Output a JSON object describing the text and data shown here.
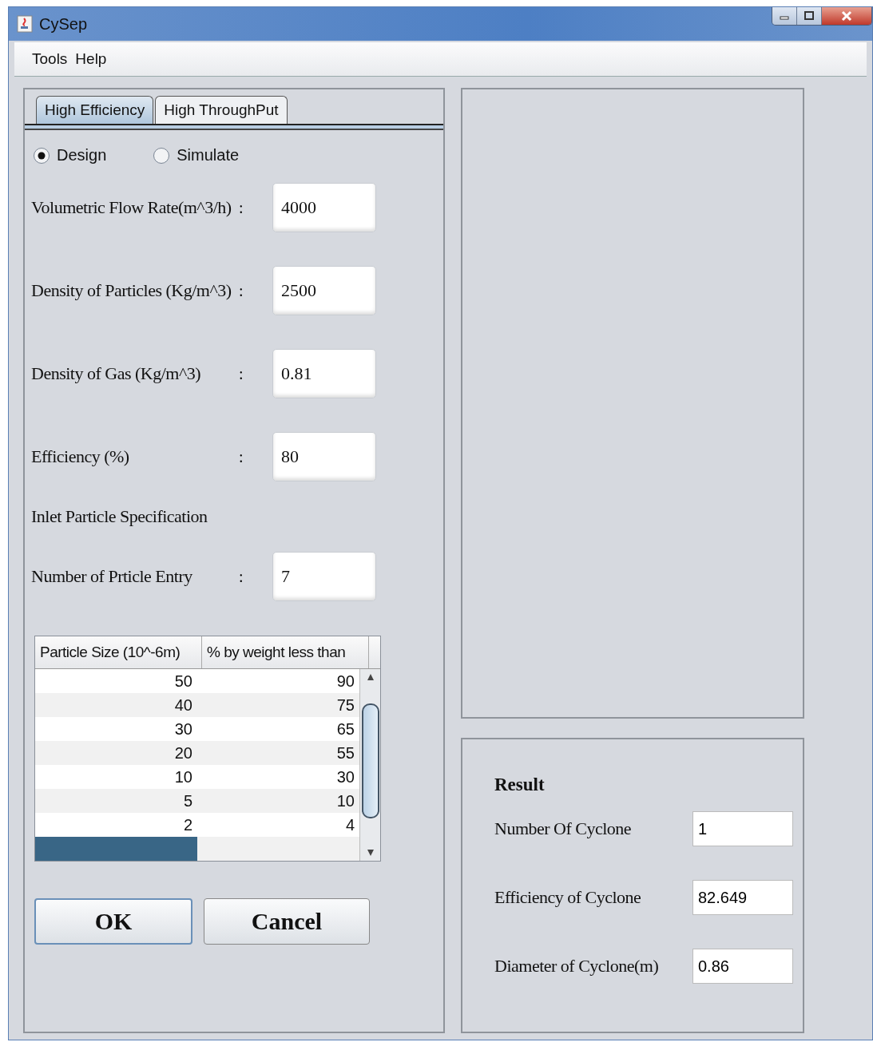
{
  "window": {
    "title": "CySep"
  },
  "menu": [
    "Tools",
    "Help"
  ],
  "tabs": [
    {
      "label": "High Efficiency",
      "selected": true
    },
    {
      "label": "High ThroughPut",
      "selected": false
    }
  ],
  "modes": [
    {
      "label": "Design",
      "selected": true
    },
    {
      "label": "Simulate",
      "selected": false
    }
  ],
  "fields": [
    {
      "label": "Volumetric Flow Rate(m^3/h)",
      "sep": ":",
      "value": "4000"
    },
    {
      "label": "Density of Particles (Kg/m^3)",
      "sep": ":",
      "value": "2500"
    },
    {
      "label": "Density of Gas (Kg/m^3)",
      "sep": ":",
      "value": "0.81"
    },
    {
      "label": "Efficiency  (%)",
      "sep": ":",
      "value": "80"
    }
  ],
  "section_heading": "Inlet Particle Specification",
  "entry_field": {
    "label": "Number of Prticle Entry",
    "sep": ":",
    "value": "7"
  },
  "table": {
    "columns": [
      "Particle Size (10^-6m)",
      "% by weight less than"
    ],
    "rows": [
      {
        "cells": [
          "50",
          "90"
        ],
        "selected": false
      },
      {
        "cells": [
          "40",
          "75"
        ],
        "selected": false
      },
      {
        "cells": [
          "30",
          "65"
        ],
        "selected": false
      },
      {
        "cells": [
          "20",
          "55"
        ],
        "selected": false
      },
      {
        "cells": [
          "10",
          "30"
        ],
        "selected": false
      },
      {
        "cells": [
          "5",
          "10"
        ],
        "selected": false
      },
      {
        "cells": [
          "2",
          "4"
        ],
        "selected": false
      },
      {
        "cells": [],
        "selected": true
      }
    ]
  },
  "buttons": [
    {
      "label": "OK",
      "focused": true
    },
    {
      "label": "Cancel",
      "focused": false
    }
  ],
  "result": {
    "title": "Result",
    "fields": [
      {
        "label": "Number Of Cyclone",
        "value": "1"
      },
      {
        "label": "Efficiency of Cyclone",
        "value": "82.649"
      },
      {
        "label": "Diameter of Cyclone(m)",
        "value": "0.86"
      }
    ]
  }
}
